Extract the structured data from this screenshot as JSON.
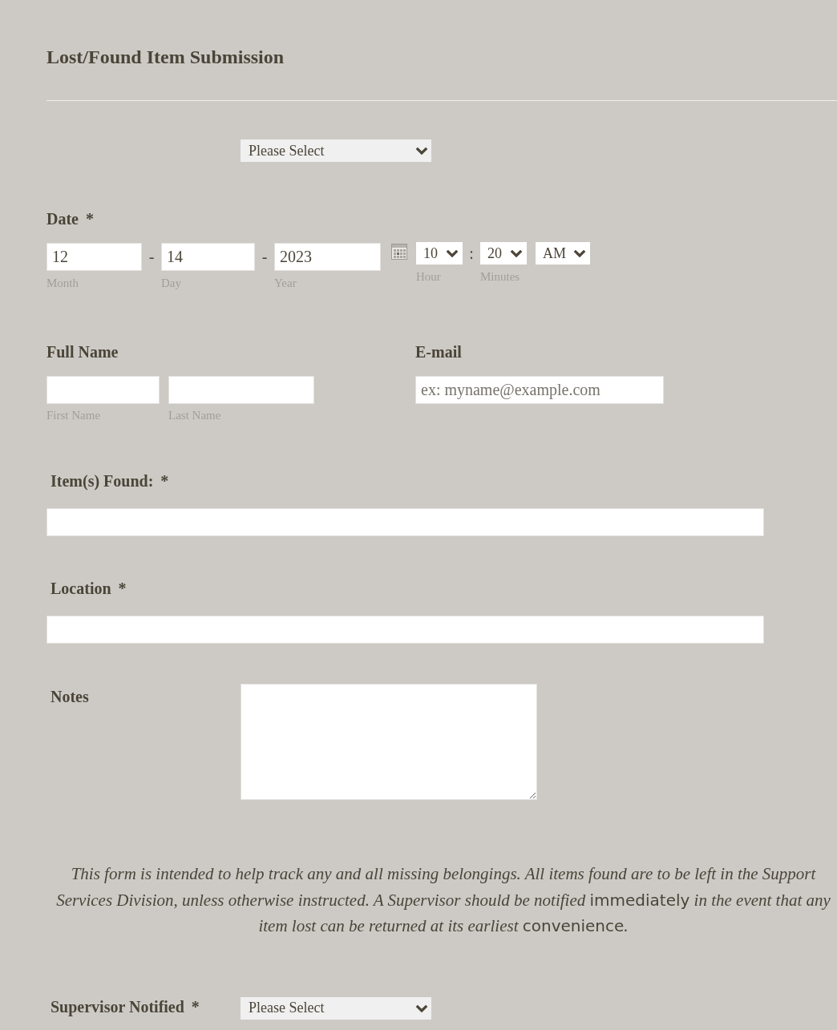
{
  "form": {
    "title": "Lost/Found Item Submission"
  },
  "fields": [
    {
      "kind": "select",
      "value": "Please Select"
    },
    {
      "kind": "datetime",
      "label": "Date",
      "required_mark": "*",
      "date": [
        {
          "value": "12",
          "sublabel": "Month"
        },
        {
          "value": "14",
          "sublabel": "Day"
        },
        {
          "value": "2023",
          "sublabel": "Year"
        }
      ],
      "date_separators": [
        "-",
        "-"
      ],
      "time": [
        {
          "value": "10",
          "sublabel": "Hour"
        },
        {
          "value": "20",
          "sublabel": "Minutes"
        },
        {
          "value": "AM"
        }
      ],
      "time_separator": ":"
    },
    {
      "kind": "columns",
      "columns": [
        {
          "kind": "name",
          "label": "Full Name",
          "inputs": [
            {
              "sublabel": "First Name"
            },
            {
              "sublabel": "Last Name"
            }
          ]
        },
        {
          "kind": "email",
          "label": "E-mail",
          "placeholder": "ex: myname@example.com"
        }
      ]
    },
    {
      "kind": "text",
      "label": "Item(s) Found:",
      "required_mark": "*"
    },
    {
      "kind": "text",
      "label": "Location",
      "required_mark": "*"
    },
    {
      "kind": "textarea",
      "label": "Notes"
    },
    {
      "kind": "notice",
      "parts": [
        {
          "kind": "plain",
          "text": "This form is intended to help track any and all missing belongings. All items found are to be left in the Support Services Division, unless otherwise instructed. A Supervisor should be notified "
        },
        {
          "kind": "sans",
          "text": "immediately"
        },
        {
          "kind": "plain",
          "text": " in the event that any item lost can be returned at its earliest "
        },
        {
          "kind": "sans",
          "text": "convenience"
        },
        {
          "kind": "plain",
          "text": "."
        }
      ]
    },
    {
      "kind": "select",
      "label": "Supervisor Notified",
      "required_mark": "*",
      "value": "Please Select"
    }
  ]
}
